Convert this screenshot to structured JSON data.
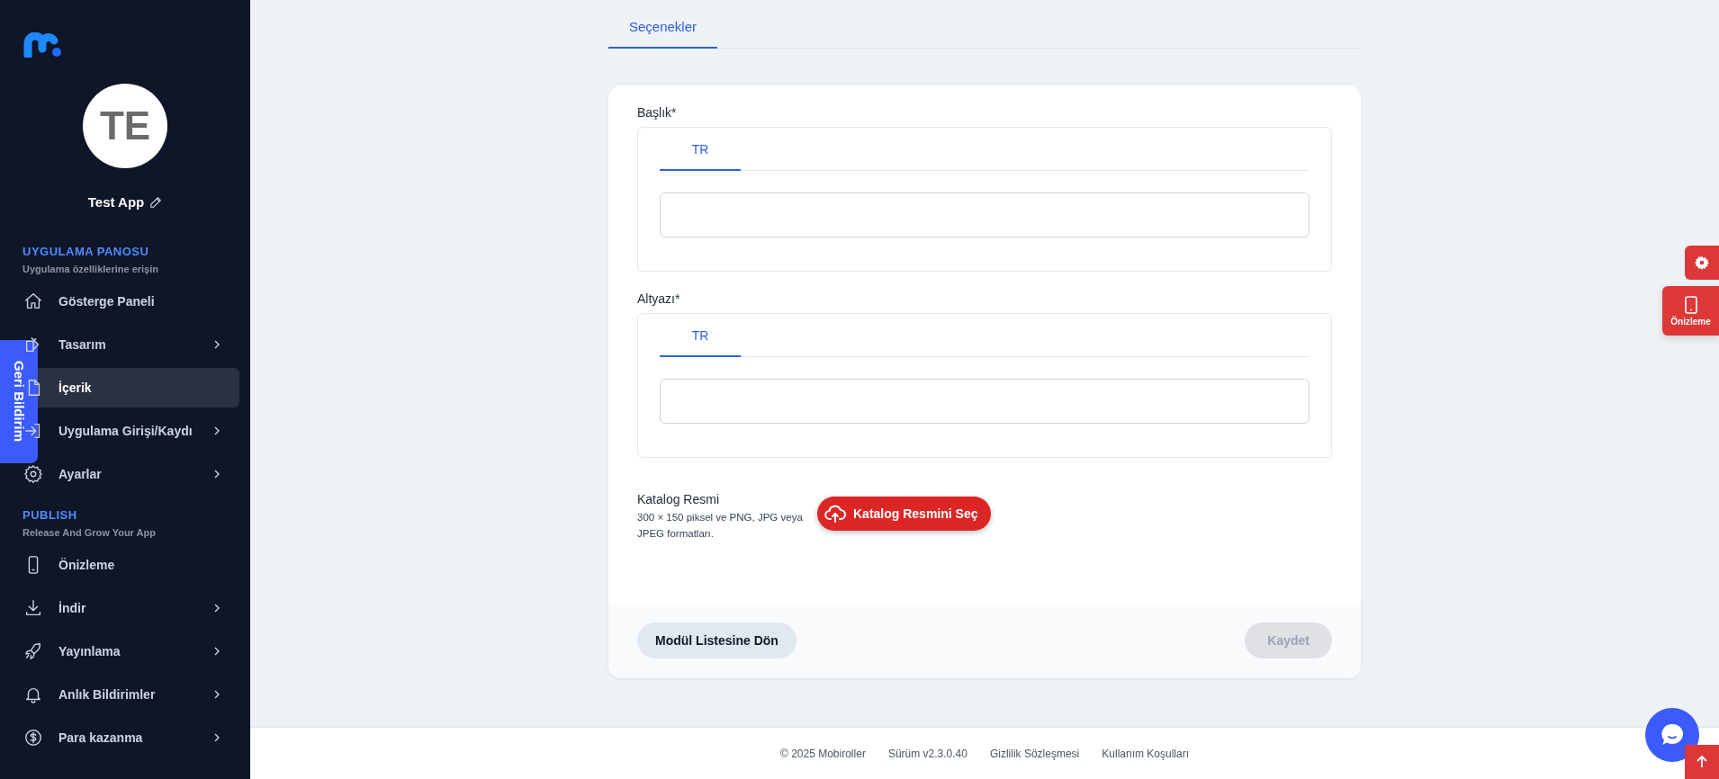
{
  "sidebar": {
    "avatar_initials": "TE",
    "app_name": "Test App",
    "sections": [
      {
        "title": "UYGULAMA PANOSU",
        "subtitle": "Uygulama özelliklerine erişin",
        "items": [
          {
            "label": "Gösterge Paneli",
            "kind": "home",
            "selected": false,
            "has_submenu": false
          },
          {
            "label": "Tasarım",
            "kind": "design",
            "selected": false,
            "has_submenu": true
          },
          {
            "label": "İçerik",
            "kind": "content",
            "selected": true,
            "has_submenu": false
          },
          {
            "label": "Uygulama Girişi/Kaydı",
            "kind": "login",
            "selected": false,
            "has_submenu": true
          },
          {
            "label": "Ayarlar",
            "kind": "settings",
            "selected": false,
            "has_submenu": true
          }
        ]
      },
      {
        "title": "PUBLISH",
        "subtitle": "Release And Grow Your App",
        "items": [
          {
            "label": "Önizleme",
            "kind": "phone",
            "selected": false,
            "has_submenu": false
          },
          {
            "label": "İndir",
            "kind": "download",
            "selected": false,
            "has_submenu": true
          },
          {
            "label": "Yayınlama",
            "kind": "rocket",
            "selected": false,
            "has_submenu": true
          },
          {
            "label": "Anlık Bildirimler",
            "kind": "bell",
            "selected": false,
            "has_submenu": true
          },
          {
            "label": "Para kazanma",
            "kind": "dollar",
            "selected": false,
            "has_submenu": true
          }
        ]
      }
    ]
  },
  "feedback_tab": {
    "label": "Geri Bildirim"
  },
  "tabs": [
    {
      "label": "Seçenekler",
      "selected": true
    }
  ],
  "form": {
    "fields": [
      {
        "label": "Başlık*",
        "languages": [
          {
            "label": "TR",
            "selected": true
          }
        ]
      },
      {
        "label": "Altyazı*",
        "languages": [
          {
            "label": "TR",
            "selected": true
          }
        ]
      }
    ],
    "image": {
      "label": "Katalog Resmi",
      "description": "300 × 150 piksel ve PNG, JPG veya JPEG formatları.",
      "button": "Katalog Resmini Seç"
    },
    "back_button": "Modül Listesine Dön",
    "save_button": {
      "label": "Kaydet",
      "disabled": true
    }
  },
  "side_buttons": {
    "preview_label": "Önizleme"
  },
  "footer": [
    "© 2025 Mobiroller",
    "Sürüm v2.3.0.40",
    "Gizlilik Sözleşmesi",
    "Kullanım Koşulları"
  ]
}
